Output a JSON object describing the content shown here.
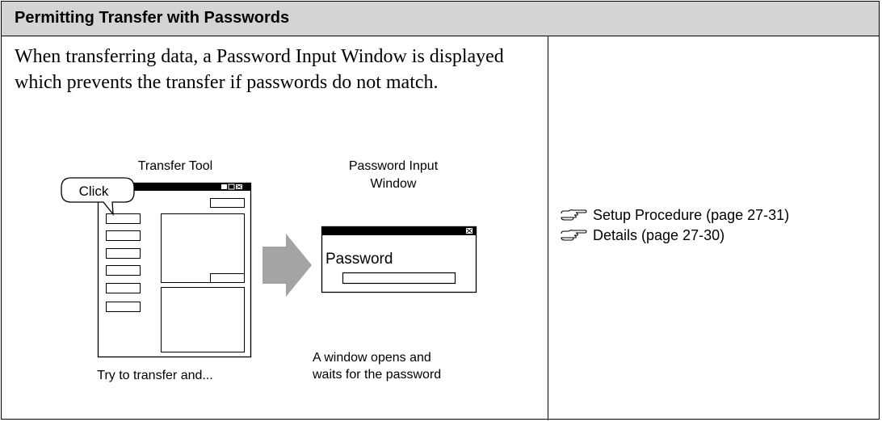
{
  "header": {
    "title": "Permitting Transfer with Passwords"
  },
  "description": "When transferring data, a Password Input Window is displayed which prevents the transfer if passwords do not match.",
  "illustration": {
    "transfer_tool_label": "Transfer Tool",
    "click_callout": "Click",
    "password_window_title_line1": "Password Input",
    "password_window_title_line2": "Window",
    "password_label": "Password",
    "caption_left": "Try to transfer and...",
    "caption_right_line1": "A window opens and",
    "caption_right_line2": "waits for the password"
  },
  "references": [
    {
      "icon": "pointing-hand-icon",
      "label": "Setup Procedure (page 27-31)"
    },
    {
      "icon": "pointing-hand-icon",
      "label": "Details (page 27-30)"
    }
  ]
}
